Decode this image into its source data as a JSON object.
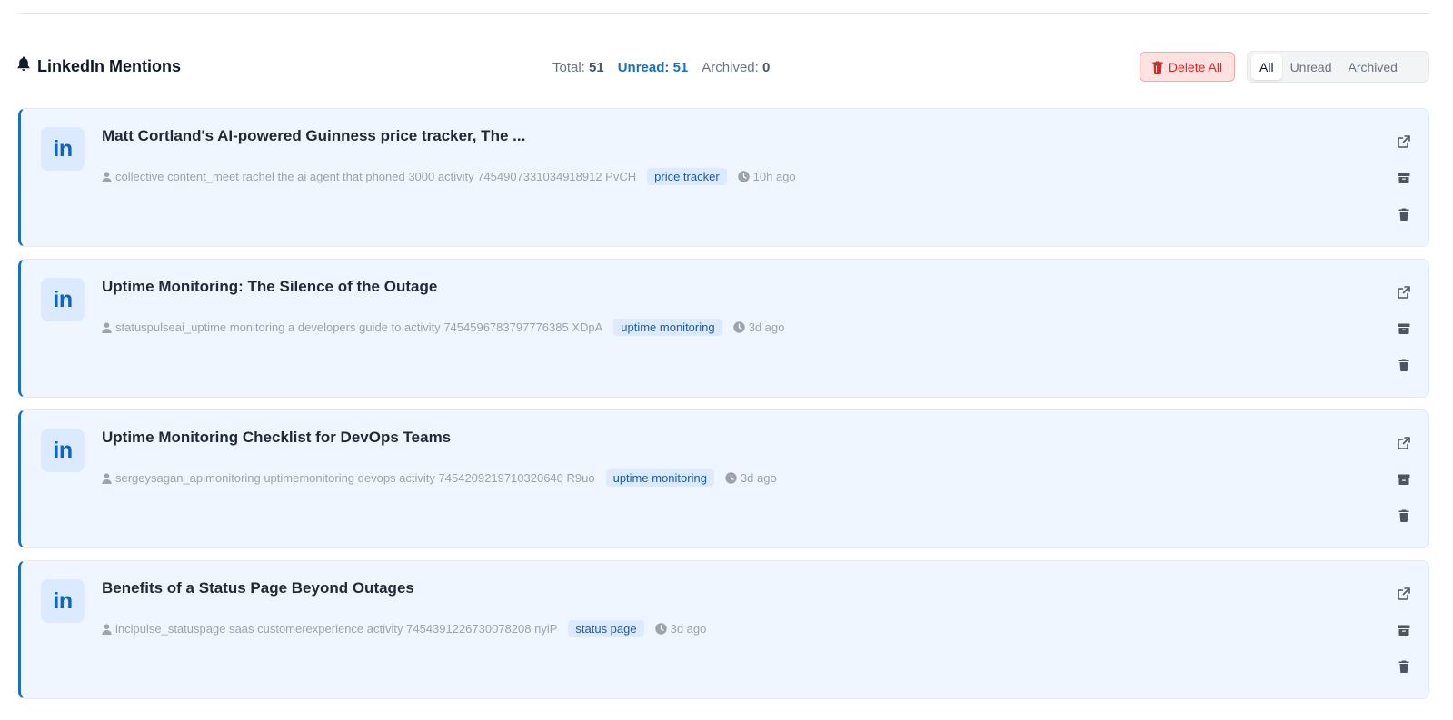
{
  "header": {
    "title": "LinkedIn Mentions",
    "stats": {
      "total_label": "Total:",
      "total_value": "51",
      "unread_label": "Unread:",
      "unread_value": "51",
      "archived_label": "Archived:",
      "archived_value": "0"
    },
    "delete_all_label": "Delete All",
    "filters": [
      "All",
      "Unread",
      "Archived"
    ],
    "active_filter": "All"
  },
  "logo_text": "in",
  "colors": {
    "accent": "#1d6fb8",
    "card_bg": "#eff6ff",
    "danger": "#dc2626"
  },
  "mentions": [
    {
      "title": "Matt Cortland's AI-powered Guinness price tracker, The ...",
      "author": "collective content_meet rachel the ai agent that phoned 3000 activity 7454907331034918912 PvCH",
      "tag": "price tracker",
      "time": "10h ago"
    },
    {
      "title": "Uptime Monitoring: The Silence of the Outage",
      "author": "statuspulseai_uptime monitoring a developers guide to activity 7454596783797776385 XDpA",
      "tag": "uptime monitoring",
      "time": "3d ago"
    },
    {
      "title": "Uptime Monitoring Checklist for DevOps Teams",
      "author": "sergeysagan_apimonitoring uptimemonitoring devops activity 7454209219710320640 R9uo",
      "tag": "uptime monitoring",
      "time": "3d ago"
    },
    {
      "title": "Benefits of a Status Page Beyond Outages",
      "author": "incipulse_statuspage saas customerexperience activity 7454391226730078208 nyiP",
      "tag": "status page",
      "time": "3d ago"
    }
  ],
  "icons": {
    "bell": "bell-icon",
    "trash": "trash-icon",
    "user": "user-icon",
    "clock": "clock-icon",
    "external_link": "external-link-icon",
    "archive": "archive-icon"
  }
}
